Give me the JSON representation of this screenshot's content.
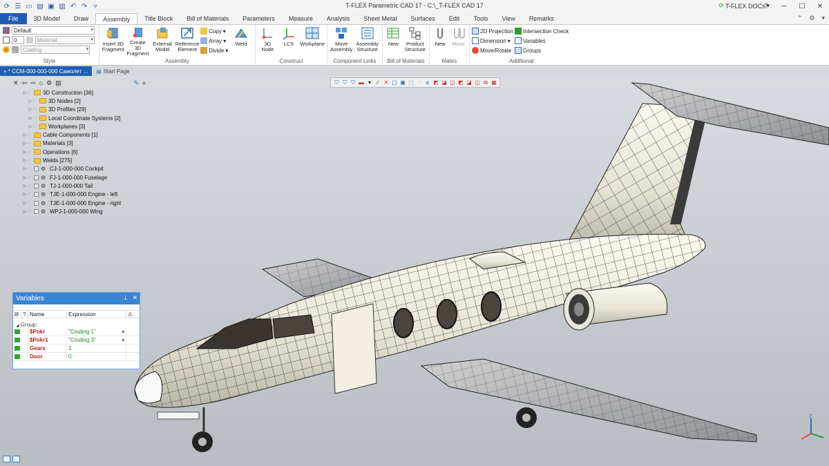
{
  "app": {
    "title": "T-FLEX Parametric CAD 17 - C:\\_T-FLEX CAD 17",
    "docs_button": "T-FLEX DOCs",
    "docs_arrow": "▾"
  },
  "tabs": [
    "File",
    "3D Model",
    "Draw",
    "Assembly",
    "Title Block",
    "Bill of Materials",
    "Parameters",
    "Measure",
    "Analysis",
    "Sheet Metal",
    "Surfaces",
    "Edit",
    "Tools",
    "View",
    "Remarks"
  ],
  "style_group": {
    "style_value": "Default",
    "width_value": "0",
    "material_placeholder": "Material",
    "coating_placeholder": "Coating",
    "label": "Style"
  },
  "ribbon": {
    "assembly": {
      "label": "Assembly",
      "insert3d": "Insert 3D Fragment",
      "create3d": "Create 3D Fragment",
      "external": "External Model",
      "reference": "Reference Element",
      "copy": "Copy",
      "array": "Array",
      "divide": "Divide",
      "weld": "Weld"
    },
    "construct": {
      "label": "Construct",
      "node3d": "3D Node",
      "lcs": "LCS",
      "workplane": "Workplane"
    },
    "links": {
      "label": "Component Links",
      "move_assembly": "Move Assembly",
      "assembly_structure": "Assembly Structure"
    },
    "bom": {
      "label": "Bill of Materials",
      "new": "New",
      "product_structure": "Product Structure"
    },
    "mates": {
      "label": "Mates",
      "new": "New",
      "move": "Move"
    },
    "additional": {
      "label": "Additional",
      "projection2d": "2D Projection",
      "dimension": "Dimension",
      "move_rotate": "Move/Rotate",
      "intersection": "Intersection Check",
      "variables": "Variables",
      "groups": "Groups"
    }
  },
  "doc_tabs": {
    "active": "* CCM-000-000-000 Самолет ...",
    "start": "Start Page"
  },
  "tree": [
    {
      "label": "3D Construction [36]",
      "indent": 0,
      "icon": "folder"
    },
    {
      "label": "3D Nodes [2]",
      "indent": 1,
      "icon": "folder"
    },
    {
      "label": "3D Profiles [29]",
      "indent": 1,
      "icon": "folder"
    },
    {
      "label": "Local Coordinate Systems [2]",
      "indent": 1,
      "icon": "folder"
    },
    {
      "label": "Workplanes [3]",
      "indent": 1,
      "icon": "folder"
    },
    {
      "label": "Cable Components [1]",
      "indent": 0,
      "icon": "folder"
    },
    {
      "label": "Materials [3]",
      "indent": 0,
      "icon": "folder"
    },
    {
      "label": "Operations [6]",
      "indent": 0,
      "icon": "folder"
    },
    {
      "label": "Welds [275]",
      "indent": 0,
      "icon": "folder"
    },
    {
      "label": "CJ-1-000-000 Cockpit",
      "indent": 0,
      "icon": "part"
    },
    {
      "label": "FJ-1-000-000 Fuselage",
      "indent": 0,
      "icon": "part"
    },
    {
      "label": "TJ-1-000-000 Tail",
      "indent": 0,
      "icon": "part"
    },
    {
      "label": "TJE-1-000-000 Engine - left",
      "indent": 0,
      "icon": "part"
    },
    {
      "label": "TJE-1-000-000 Engine - right",
      "indent": 0,
      "icon": "part"
    },
    {
      "label": "WPJ-1-000-000 Wing",
      "indent": 0,
      "icon": "part"
    }
  ],
  "variables": {
    "title": "Variables",
    "col_q": "?",
    "col_name": "Name",
    "col_expr": "Expression",
    "group": "Group:",
    "rows": [
      {
        "name": "$Pokr",
        "expr": "\"Couting 1\"",
        "dropdown": true
      },
      {
        "name": "$Pokr1",
        "expr": "\"Couting 3\"",
        "dropdown": true
      },
      {
        "name": "Gears",
        "expr": "1",
        "dropdown": false
      },
      {
        "name": "Door",
        "expr": "0",
        "dropdown": false
      }
    ]
  },
  "colors": {
    "accent": "#1d5fb3",
    "panel_title": "#3a84d4",
    "var_name": "#b3211f",
    "var_expr": "#18881a"
  }
}
